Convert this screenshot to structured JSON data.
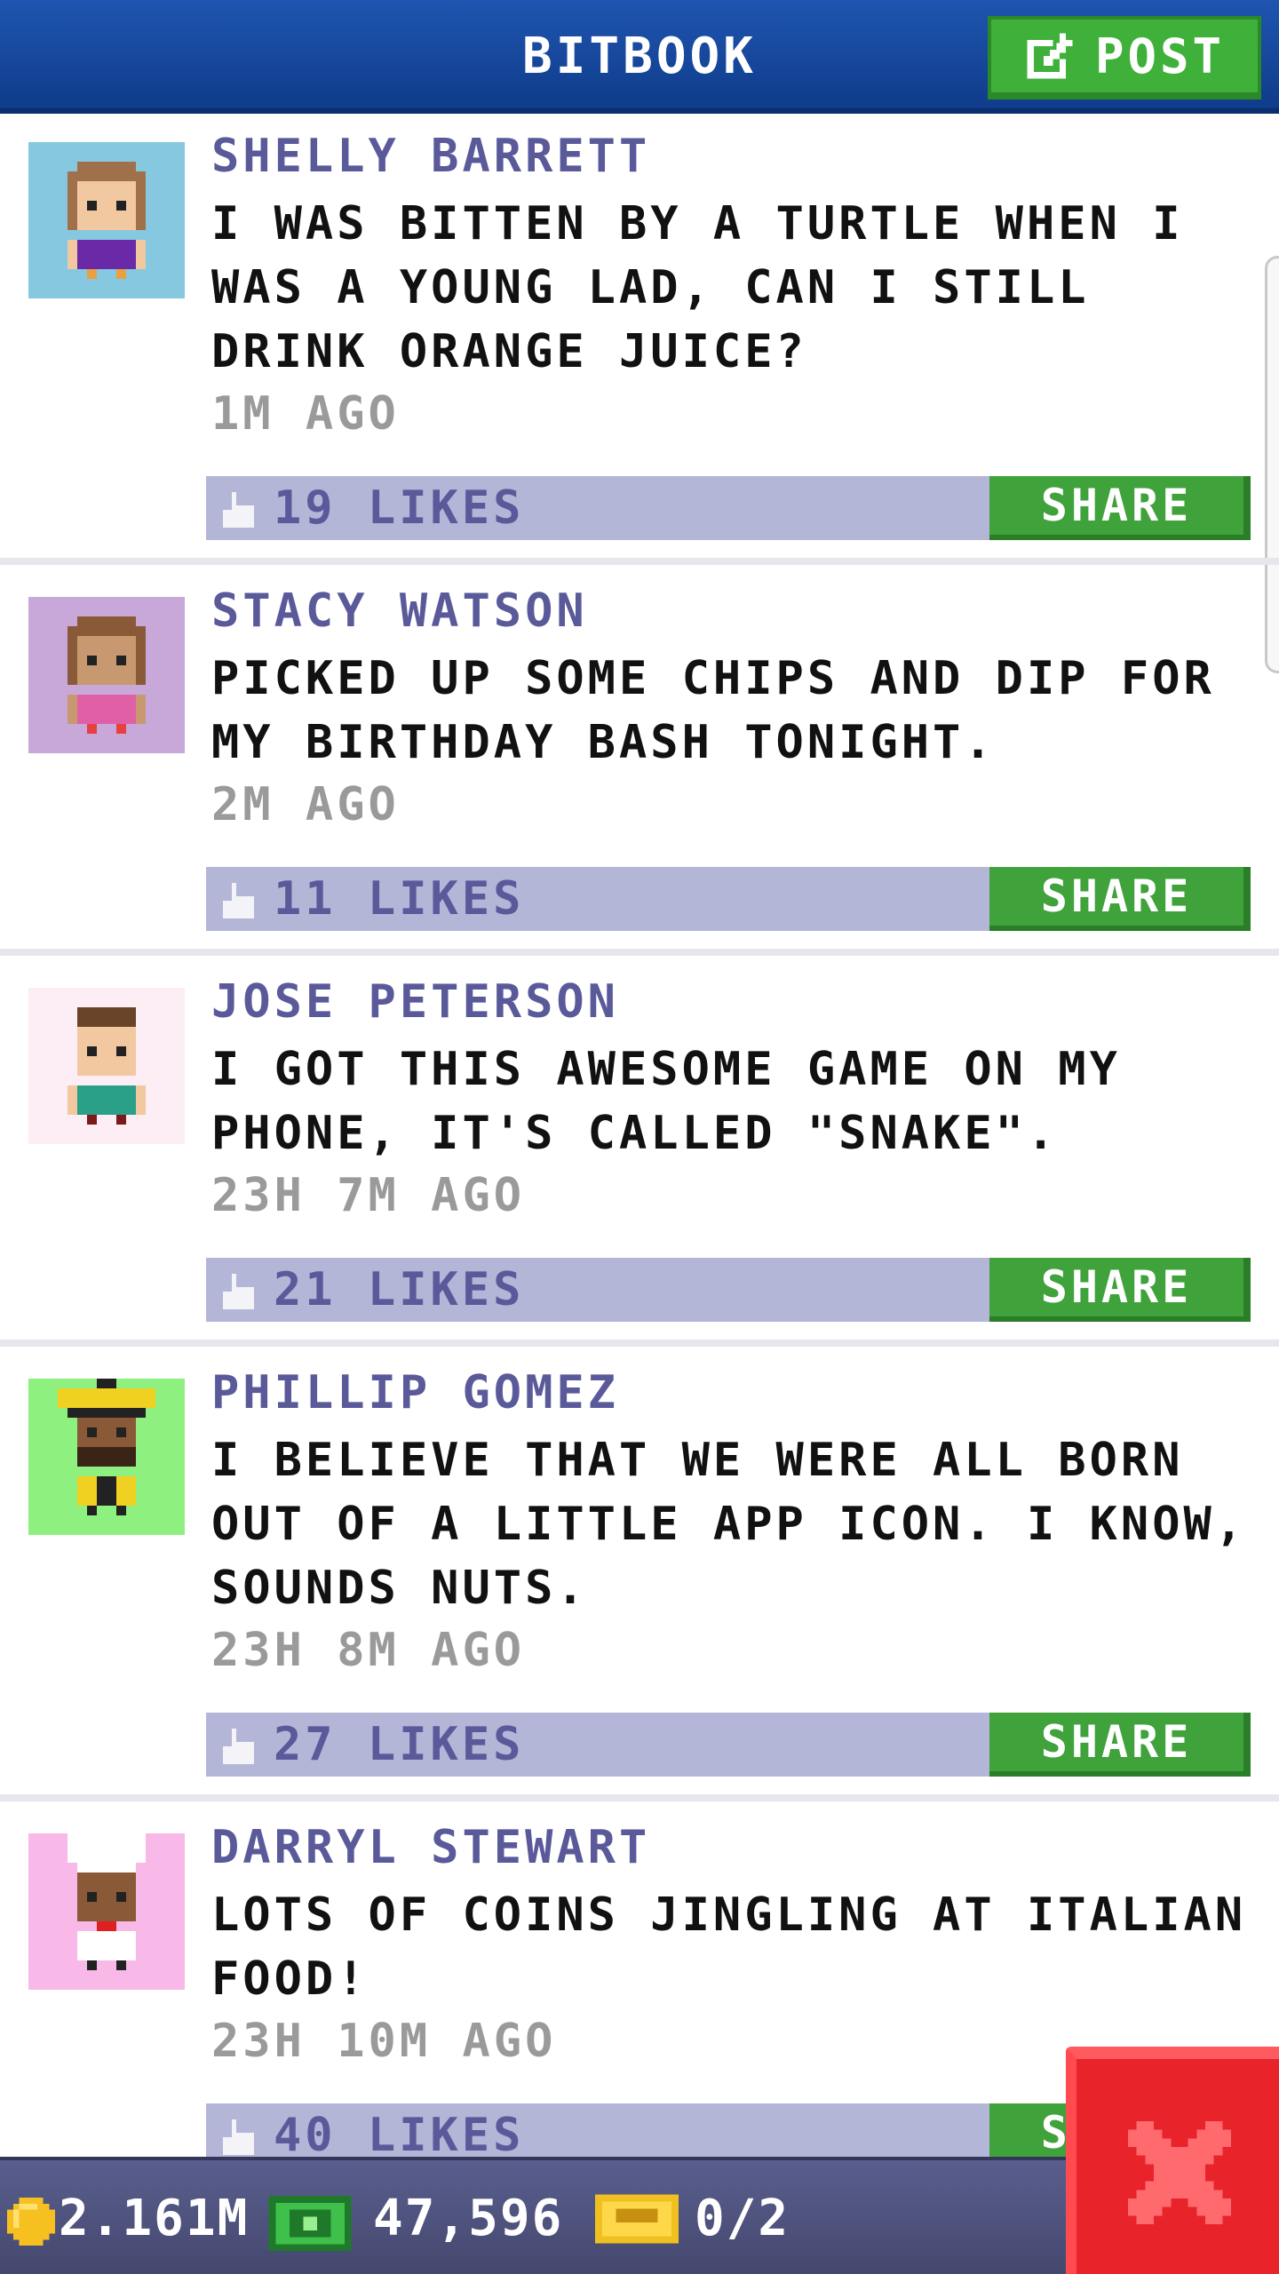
{
  "header": {
    "title": "BITBOOK",
    "post_label": "POST"
  },
  "posts": [
    {
      "author": "SHELLY BARRETT",
      "message": "I WAS BITTEN BY A TURTLE WHEN I WAS A YOUNG LAD, CAN I STILL DRINK ORANGE JUICE?",
      "time": "1M AGO",
      "likes": "19 LIKES",
      "share": "SHARE",
      "avatar_bg": "#86c8e0"
    },
    {
      "author": "STACY WATSON",
      "message": "PICKED UP SOME CHIPS AND DIP FOR MY BIRTHDAY BASH TONIGHT.",
      "time": "2M AGO",
      "likes": "11 LIKES",
      "share": "SHARE",
      "avatar_bg": "#c8a8d8"
    },
    {
      "author": "JOSE PETERSON",
      "message": "I GOT THIS AWESOME GAME ON MY PHONE, IT'S CALLED \"SNAKE\".",
      "time": "23H 7M AGO",
      "likes": "21 LIKES",
      "share": "SHARE",
      "avatar_bg": "#fceef4"
    },
    {
      "author": "PHILLIP GOMEZ",
      "message": "I BELIEVE THAT WE WERE ALL BORN OUT OF A LITTLE APP ICON. I KNOW, SOUNDS NUTS.",
      "time": "23H 8M AGO",
      "likes": "27 LIKES",
      "share": "SHARE",
      "avatar_bg": "#8ef07e"
    },
    {
      "author": "DARRYL STEWART",
      "message": "LOTS OF COINS JINGLING AT ITALIAN FOOD!",
      "time": "23H 10M AGO",
      "likes": "40 LIKES",
      "share": "SHARE",
      "avatar_bg": "#f8b8e8"
    }
  ],
  "status": {
    "coins": "2.161M",
    "bux": "47,596",
    "tickets": "0/2"
  },
  "colors": {
    "header": "#1f55b0",
    "share": "#3fa23a",
    "like_bar": "#b4b6d8",
    "close": "#e8232a"
  },
  "icons": {
    "post": "edit-icon",
    "like": "thumbs-up-icon",
    "close": "close-icon",
    "coin": "coin-icon",
    "bux": "cash-icon",
    "ticket": "ticket-icon"
  }
}
